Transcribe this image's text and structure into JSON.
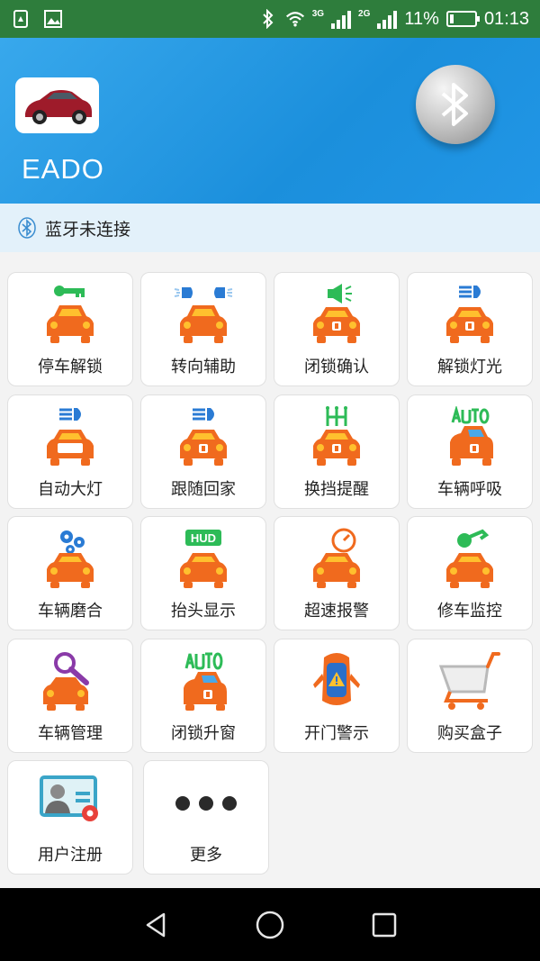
{
  "status_bar": {
    "network_3g": "3G",
    "network_2g": "2G",
    "battery": "11%",
    "time": "01:13"
  },
  "header": {
    "title": "EADO"
  },
  "bluetooth": {
    "status": "蓝牙未连接"
  },
  "tiles": [
    {
      "label": "停车解锁",
      "icon": "key-car-icon"
    },
    {
      "label": "转向辅助",
      "icon": "turn-lights-car-icon"
    },
    {
      "label": "闭锁确认",
      "icon": "horn-car-icon"
    },
    {
      "label": "解锁灯光",
      "icon": "headlight-car-icon"
    },
    {
      "label": "自动大灯",
      "icon": "auto-headlight-car-icon"
    },
    {
      "label": "跟随回家",
      "icon": "follow-home-car-icon"
    },
    {
      "label": "换挡提醒",
      "icon": "gear-shift-car-icon"
    },
    {
      "label": "车辆呼吸",
      "icon": "auto-breathing-car-icon"
    },
    {
      "label": "车辆磨合",
      "icon": "gears-car-icon"
    },
    {
      "label": "抬头显示",
      "icon": "hud-car-icon"
    },
    {
      "label": "超速报警",
      "icon": "speedometer-car-icon"
    },
    {
      "label": "修车监控",
      "icon": "wrench-car-icon"
    },
    {
      "label": "车辆管理",
      "icon": "magnifier-car-icon"
    },
    {
      "label": "闭锁升窗",
      "icon": "auto-window-car-icon"
    },
    {
      "label": "开门警示",
      "icon": "door-warning-car-icon"
    },
    {
      "label": "购买盒子",
      "icon": "shopping-cart-icon"
    },
    {
      "label": "用户注册",
      "icon": "user-card-icon"
    },
    {
      "label": "更多",
      "icon": "more-dots-icon"
    }
  ],
  "colors": {
    "header_blue": "#2196e6",
    "car_orange": "#f06a1e",
    "car_window": "#ffc02e",
    "status_green": "#2e7d3c"
  }
}
